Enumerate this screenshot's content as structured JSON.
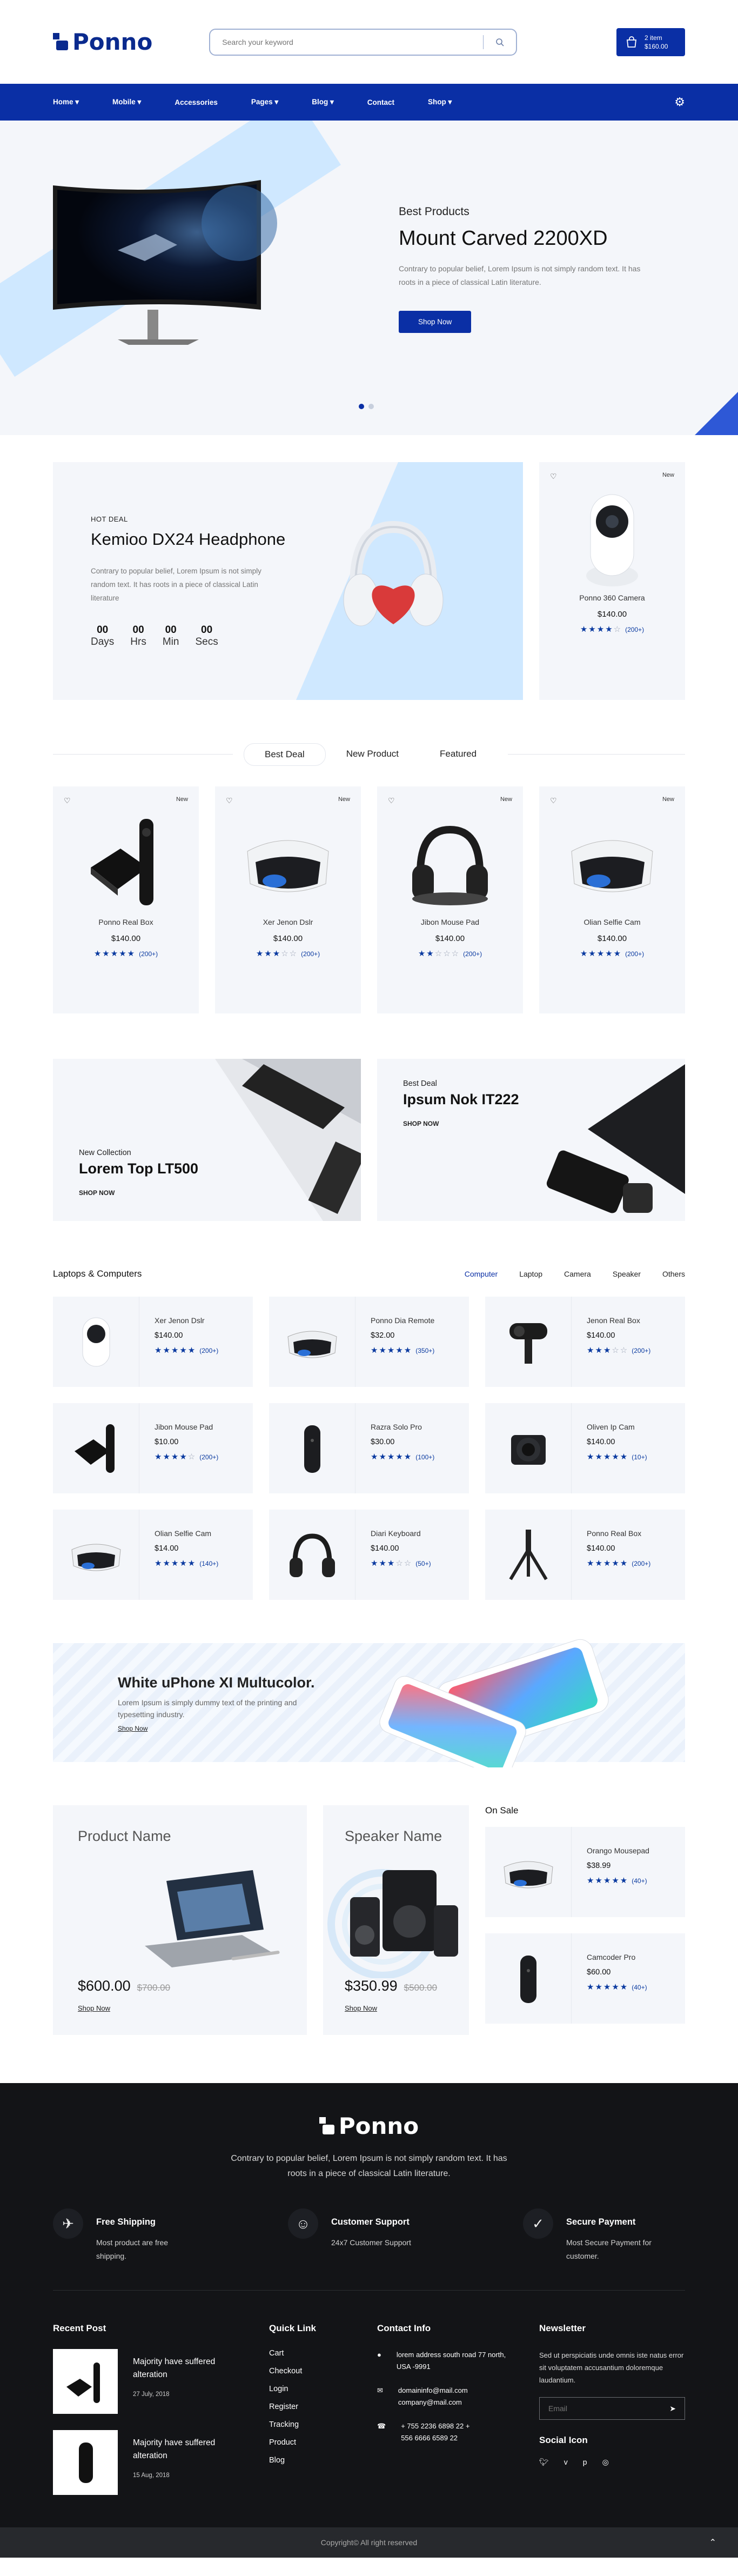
{
  "brand": {
    "name": "Ponno"
  },
  "header": {
    "search_placeholder": "Search your keyword",
    "cart_items": "2 item",
    "cart_total": "$160.00"
  },
  "nav": {
    "items": [
      "Home ▾",
      "Mobile ▾",
      "Accessories",
      "Pages ▾",
      "Blog ▾",
      "Contact",
      "Shop ▾"
    ]
  },
  "hero": {
    "kicker": "Best Products",
    "title": "Mount Carved 2200XD",
    "text": "Contrary to popular belief, Lorem Ipsum is not simply random text. It has roots in a piece of classical Latin literature.",
    "button": "Shop Now"
  },
  "deal": {
    "tag": "HOT DEAL",
    "title": "Kemioo DX24 Headphone",
    "text": "Contrary to popular belief, Lorem Ipsum is not simply random text. It has roots in a piece of classical Latin literature",
    "countdown": [
      {
        "v": "00",
        "l": "Days"
      },
      {
        "v": "00",
        "l": "Hrs"
      },
      {
        "v": "00",
        "l": "Min"
      },
      {
        "v": "00",
        "l": "Secs"
      }
    ]
  },
  "side_card": {
    "badge": "New",
    "name": "Ponno 360 Camera",
    "price": "$140.00",
    "rating": 4,
    "count": "(200+)"
  },
  "tabs": [
    "Best Deal",
    "New Product",
    "Featured"
  ],
  "products": [
    {
      "badge": "New",
      "name": "Ponno Real Box",
      "price": "$140.00",
      "rating": 5,
      "count": "(200+)"
    },
    {
      "badge": "New",
      "name": "Xer Jenon Dslr",
      "price": "$140.00",
      "rating": 3,
      "count": "(200+)"
    },
    {
      "badge": "New",
      "name": "Jibon Mouse Pad",
      "price": "$140.00",
      "rating": 2,
      "count": "(200+)"
    },
    {
      "badge": "New",
      "name": "Olian Selfie Cam",
      "price": "$140.00",
      "rating": 5,
      "count": "(200+)"
    }
  ],
  "banners": [
    {
      "sub": "New Collection",
      "title": "Lorem Top LT500",
      "link": "SHOP NOW"
    },
    {
      "sub": "Best Deal",
      "title": "Ipsum Nok IT222",
      "link": "SHOP NOW"
    }
  ],
  "category": {
    "title": "Laptops & Computers",
    "tabs": [
      "Computer",
      "Laptop",
      "Camera",
      "Speaker",
      "Others"
    ]
  },
  "list": [
    {
      "name": "Xer Jenon Dslr",
      "price": "$140.00",
      "rating": 5,
      "count": "(200+)",
      "icon": "camera"
    },
    {
      "name": "Ponno Dia Remote",
      "price": "$32.00",
      "rating": 5,
      "count": "(350+)",
      "icon": "vr"
    },
    {
      "name": "Jenon Real Box",
      "price": "$140.00",
      "rating": 3,
      "count": "(200+)",
      "icon": "webcam"
    },
    {
      "name": "Jibon Mouse Pad",
      "price": "$10.00",
      "rating": 4,
      "count": "(200+)",
      "icon": "box"
    },
    {
      "name": "Razra Solo Pro",
      "price": "$30.00",
      "rating": 5,
      "count": "(100+)",
      "icon": "speaker"
    },
    {
      "name": "Oliven Ip Cam",
      "price": "$140.00",
      "rating": 5,
      "count": "(10+)",
      "icon": "lens"
    },
    {
      "name": "Olian Selfie Cam",
      "price": "$14.00",
      "rating": 5,
      "count": "(140+)",
      "icon": "vr"
    },
    {
      "name": "Diari Keyboard",
      "price": "$140.00",
      "rating": 3,
      "count": "(50+)",
      "icon": "headphone"
    },
    {
      "name": "Ponno Real Box",
      "price": "$140.00",
      "rating": 5,
      "count": "(200+)",
      "icon": "tripod"
    }
  ],
  "phone_banner": {
    "title": "White uPhone XI Multucolor.",
    "text": "Lorem Ipsum is simply dummy text of the printing and typesetting industry.",
    "link": "Shop Now"
  },
  "promo": [
    {
      "name": "Product Name",
      "price": "$600.00",
      "old": "$700.00",
      "link": "Shop Now"
    },
    {
      "name": "Speaker Name",
      "price": "$350.99",
      "old": "$500.00",
      "link": "Shop Now"
    }
  ],
  "onsale": {
    "title": "On Sale",
    "items": [
      {
        "name": "Orango Mousepad",
        "price": "$38.99",
        "rating": 5,
        "count": "(40+)",
        "icon": "vr"
      },
      {
        "name": "Camcoder Pro",
        "price": "$60.00",
        "rating": 5,
        "count": "(40+)",
        "icon": "speaker"
      }
    ]
  },
  "footer": {
    "desc": "Contrary to popular belief, Lorem Ipsum is not simply random text. It has roots in a piece of classical Latin literature.",
    "features": [
      {
        "title": "Free Shipping",
        "text": "Most product are free shipping.",
        "icon": "✈"
      },
      {
        "title": "Customer Support",
        "text": "24x7 Customer Support",
        "icon": "☺"
      },
      {
        "title": "Secure Payment",
        "text": "Most Secure Payment for customer.",
        "icon": "✓"
      }
    ],
    "recent_title": "Recent Post",
    "posts": [
      {
        "title": "Majority have suffered alteration",
        "date": "27 July, 2018"
      },
      {
        "title": "Majority have suffered alteration",
        "date": "15 Aug, 2018"
      }
    ],
    "quick_title": "Quick Link",
    "quick": [
      "Cart",
      "Checkout",
      "Login",
      "Register",
      "Tracking",
      "Product",
      "Blog"
    ],
    "contact_title": "Contact Info",
    "contact": [
      {
        "icon": "●",
        "text": "lorem address south road 77 north, USA -9991"
      },
      {
        "icon": "✉",
        "text": "domaininfo@mail.com company@mail.com"
      },
      {
        "icon": "☎",
        "text": "+ 755 2236 6898 22 + 556 6666 6589 22"
      }
    ],
    "news_title": "Newsletter",
    "news_text": "Sed ut perspiciatis unde omnis iste natus error sit voluptatem accusantium doloremque laudantium.",
    "email_placeholder": "Email",
    "social_title": "Social Icon",
    "copyright": "Copyright© All right reserved"
  }
}
